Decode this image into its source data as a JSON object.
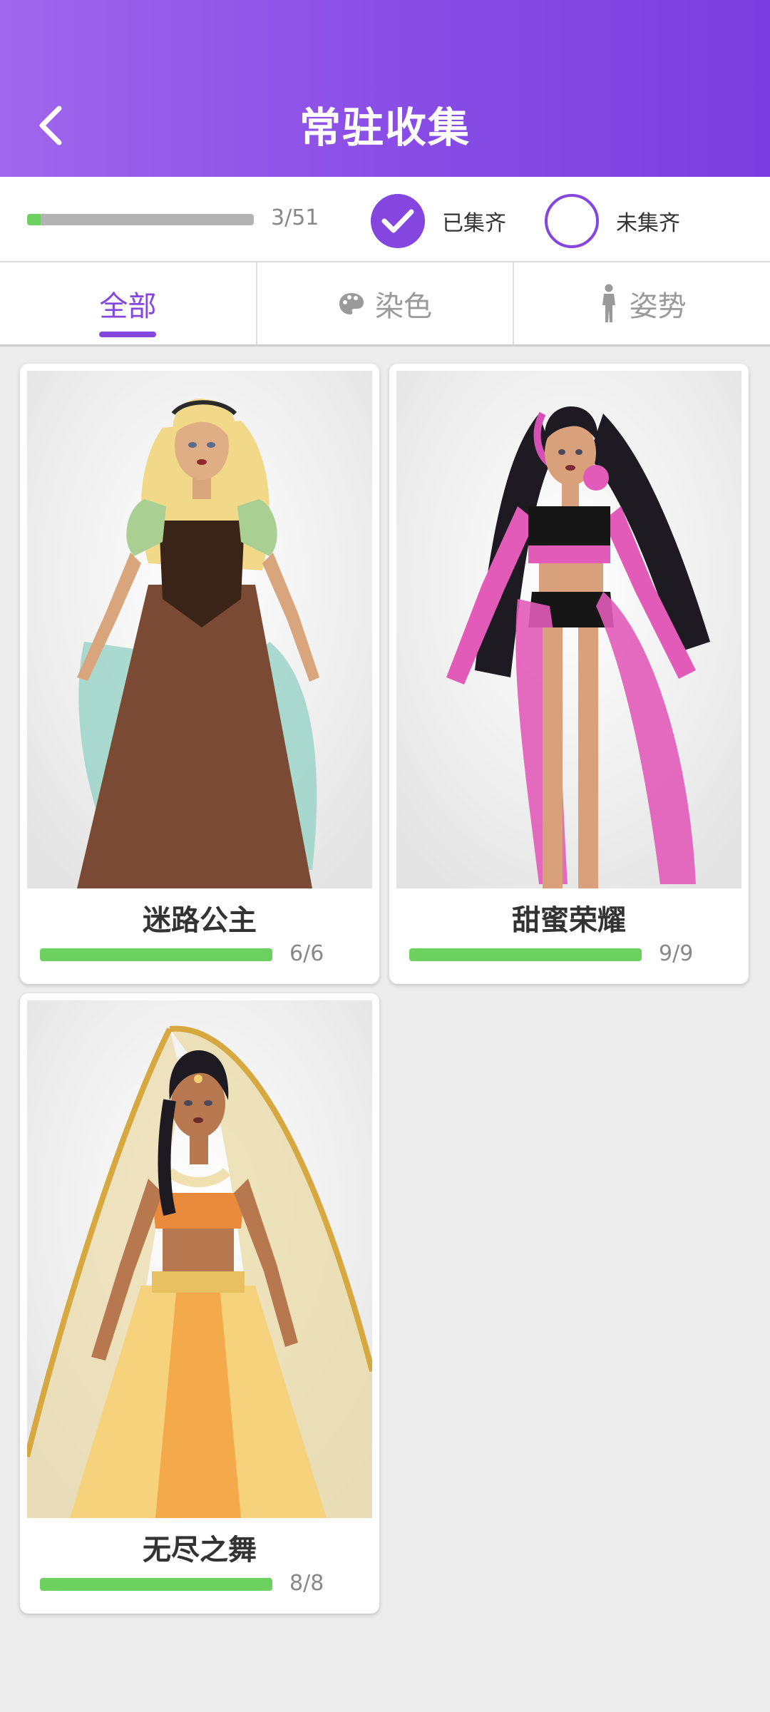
{
  "header": {
    "title": "常驻收集",
    "back_icon": "chevron-left-icon"
  },
  "progress": {
    "text": "3/51",
    "collected": 3,
    "total": 51
  },
  "filters": [
    {
      "label": "已集齐",
      "checked": true
    },
    {
      "label": "未集齐",
      "checked": false
    }
  ],
  "tabs": [
    {
      "label": "全部",
      "active": true,
      "icon": ""
    },
    {
      "label": "染色",
      "active": false,
      "icon": "palette-icon"
    },
    {
      "label": "姿势",
      "active": false,
      "icon": "person-pose-icon"
    }
  ],
  "cards": [
    {
      "name": "迷路公主",
      "count": "6/6",
      "progress": 1.0
    },
    {
      "name": "甜蜜荣耀",
      "count": "9/9",
      "progress": 1.0
    },
    {
      "name": "无尽之舞",
      "count": "8/8",
      "progress": 1.0
    }
  ],
  "colors": {
    "accent": "#8446df",
    "progress_green": "#6cd15e",
    "track_gray": "#b3b3b3"
  }
}
